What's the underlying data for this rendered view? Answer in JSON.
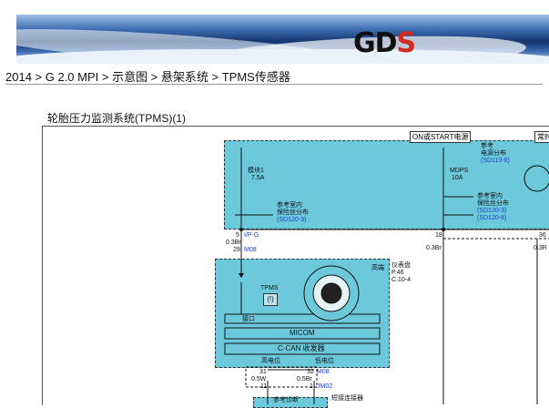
{
  "header": {
    "logo_g": "G",
    "logo_d": "D",
    "logo_s": "S"
  },
  "breadcrumb": "2014 > G 2.0 MPI > 示意图 > 悬架系统 > TPMS传感器",
  "page_title": "轮胎压力监测系统(TPMS)(1)",
  "diagram": {
    "power_label": "ON或START电源",
    "power_label2": "常时",
    "fuse1": "模块1",
    "fuse1_amp": "7.5A",
    "ref_power": "参考",
    "ref_power2": "电源分布",
    "ref_power_code": "(SD110-8)",
    "mdps": "MDPS",
    "mdps_amp": "10A",
    "ref_room1": "参考室内",
    "ref_room1b": "保险丝分布",
    "ref_room1_code": "(SD120-3)",
    "ref_room2": "参考室内",
    "ref_room2b": "保险丝分布",
    "ref_room2_code1": "(SD120-3)",
    "ref_room2_code2": "(SD120-8)",
    "pin5": "5",
    "pin5_label": "I/P-G",
    "wire1": "0.3Br",
    "pin29": "29",
    "conn_m08": "M08",
    "pin18": "18",
    "wire2": "0.3Br",
    "pin36": "36",
    "wire3": "0.3R",
    "cluster_title": "仪表盘",
    "cluster_code1": "P.46",
    "cluster_code2": "C.10-4",
    "high_side": "高端",
    "tpms": "TPMS",
    "interface": "接口",
    "micom": "MICOM",
    "ccan": "C-CAN 收发器",
    "high": "高电位",
    "low": "低电位",
    "pin31": "31",
    "wire4": "0.5W",
    "pin11": "11",
    "pin32": "32",
    "conn_m08b": "M08",
    "wire5": "0.5Br",
    "pin1": "1",
    "conn_jm02": "JM02",
    "short_conn": "短接连接器",
    "ref_bottom": "参考诊断"
  }
}
